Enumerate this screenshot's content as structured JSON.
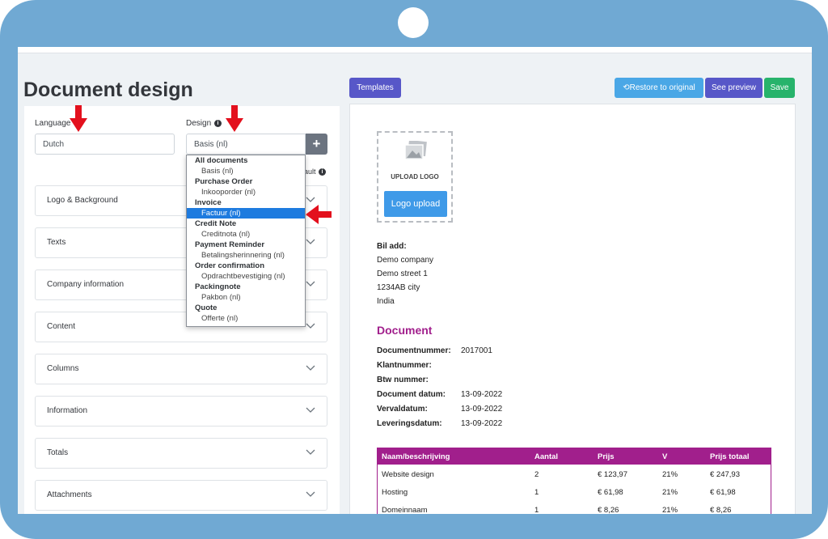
{
  "page": {
    "title": "Document design"
  },
  "form": {
    "language_label": "Language",
    "language_value": "Dutch",
    "design_label": "Design",
    "design_value": "Basis (nl)",
    "default_fragment": "ault"
  },
  "dropdown": {
    "rows": [
      {
        "text": "All documents",
        "kind": "group"
      },
      {
        "text": "Basis (nl)",
        "kind": "option"
      },
      {
        "text": "Purchase Order",
        "kind": "group"
      },
      {
        "text": "Inkooporder (nl)",
        "kind": "option"
      },
      {
        "text": "Invoice",
        "kind": "group"
      },
      {
        "text": "Factuur (nl)",
        "kind": "option",
        "selected": true
      },
      {
        "text": "Credit Note",
        "kind": "group"
      },
      {
        "text": "Creditnota (nl)",
        "kind": "option"
      },
      {
        "text": "Payment Reminder",
        "kind": "group"
      },
      {
        "text": "Betalingsherinnering (nl)",
        "kind": "option"
      },
      {
        "text": "Order confirmation",
        "kind": "group"
      },
      {
        "text": "Opdrachtbevestiging (nl)",
        "kind": "option"
      },
      {
        "text": "Packingnote",
        "kind": "group"
      },
      {
        "text": "Pakbon (nl)",
        "kind": "option"
      },
      {
        "text": "Quote",
        "kind": "group"
      },
      {
        "text": "Offerte (nl)",
        "kind": "option"
      }
    ]
  },
  "sections": [
    "Logo & Background",
    "Texts",
    "Company information",
    "Content",
    "Columns",
    "Information",
    "Totals",
    "Attachments"
  ],
  "toolbar": {
    "templates": "Templates",
    "restore": "Restore to original",
    "preview": "See preview",
    "save": "Save"
  },
  "preview": {
    "upload_logo": "UPLOAD LOGO",
    "logo_button": "Logo upload",
    "address": [
      "Bil add:",
      "Demo company",
      "Demo street 1",
      "1234AB city",
      "India"
    ],
    "heading": "Document",
    "meta": [
      {
        "key": "Documentnummer:",
        "value": "2017001"
      },
      {
        "key": "Klantnummer:",
        "value": ""
      },
      {
        "key": "Btw nummer:",
        "value": ""
      },
      {
        "key": "Document datum:",
        "value": "13-09-2022"
      },
      {
        "key": "Vervaldatum:",
        "value": "13-09-2022"
      },
      {
        "key": "Leveringsdatum:",
        "value": "13-09-2022"
      }
    ],
    "table": {
      "headers": [
        "Naam/beschrijving",
        "Aantal",
        "Prijs",
        "V",
        "Prijs totaal"
      ],
      "rows": [
        [
          "Website design",
          "2",
          "€ 123,97",
          "21%",
          "€ 247,93"
        ],
        [
          "Hosting",
          "1",
          "€ 61,98",
          "21%",
          "€ 61,98"
        ],
        [
          "Domeinnaam",
          "1",
          "€ 8,26",
          "21%",
          "€ 8,26"
        ]
      ]
    }
  },
  "colors": {
    "frame": "#70a9d3",
    "accent": "#a11f8c",
    "selected": "#1e7bdf",
    "arrow": "#e3101d"
  }
}
